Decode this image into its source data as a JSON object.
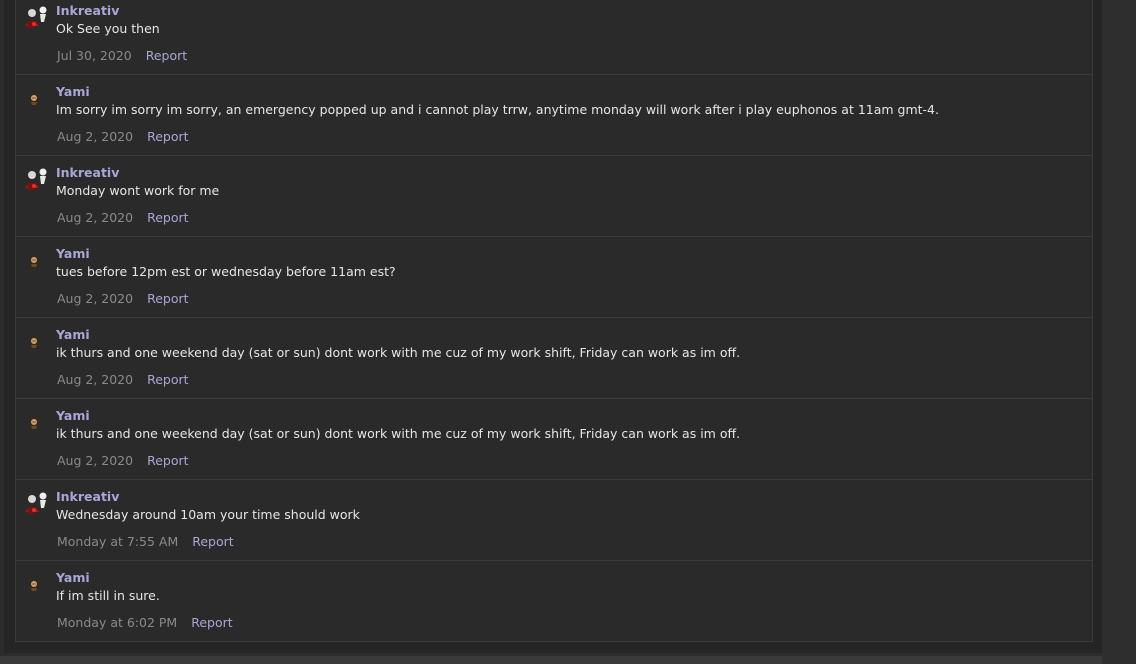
{
  "messages": [
    {
      "user": "Inkreativ",
      "avatar": "inkreativ-avatar",
      "text": "Ok See you then",
      "date": "Jul 30, 2020",
      "report": "Report"
    },
    {
      "user": "Yami",
      "avatar": "yami-avatar",
      "text": "Im sorry im sorry im sorry, an emergency popped up and i cannot play trrw, anytime monday will work after i play euphonos at 11am gmt-4.",
      "date": "Aug 2, 2020",
      "report": "Report"
    },
    {
      "user": "Inkreativ",
      "avatar": "inkreativ-avatar",
      "text": "Monday wont work for me",
      "date": "Aug 2, 2020",
      "report": "Report"
    },
    {
      "user": "Yami",
      "avatar": "yami-avatar",
      "text": "tues before 12pm est or wednesday before 11am est?",
      "date": "Aug 2, 2020",
      "report": "Report"
    },
    {
      "user": "Yami",
      "avatar": "yami-avatar",
      "text": "ik thurs and one weekend day (sat or sun) dont work with me cuz of my work shift, Friday can work as im off.",
      "date": "Aug 2, 2020",
      "report": "Report"
    },
    {
      "user": "Yami",
      "avatar": "yami-avatar",
      "text": "ik thurs and one weekend day (sat or sun) dont work with me cuz of my work shift, Friday can work as im off.",
      "date": "Aug 2, 2020",
      "report": "Report"
    },
    {
      "user": "Inkreativ",
      "avatar": "inkreativ-avatar",
      "text": "Wednesday around 10am your time should work",
      "date": "Monday at 7:55 AM",
      "report": "Report"
    },
    {
      "user": "Yami",
      "avatar": "yami-avatar",
      "text": "If im still in sure.",
      "date": "Monday at 6:02 PM",
      "report": "Report"
    }
  ],
  "colors": {
    "username": "#a9a7d6",
    "link": "#a9a7d6",
    "text": "#e6e6e6",
    "meta": "#8a8a8a",
    "panel": "#2a2a2a",
    "border": "#3c3c3c"
  }
}
